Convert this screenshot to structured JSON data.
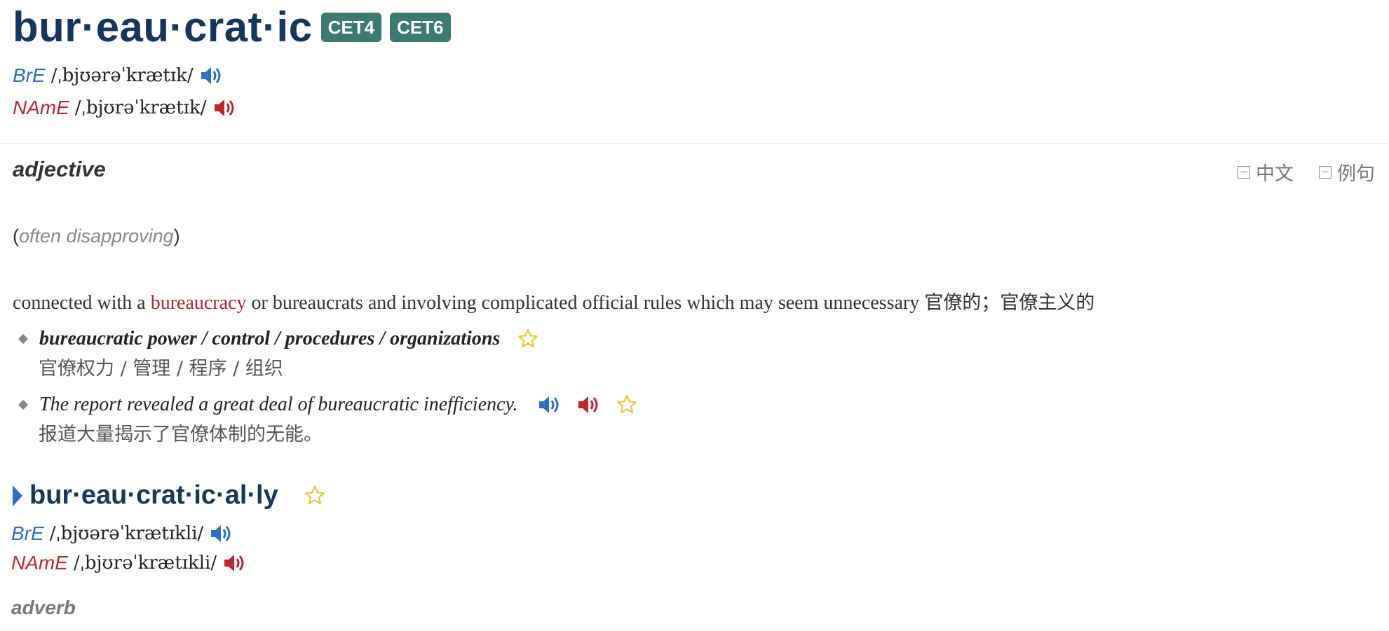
{
  "entry": {
    "headword": "bur·eau·crat·ic",
    "badges": [
      "CET4",
      "CET6"
    ],
    "pron": {
      "bre_label": "BrE",
      "bre_ipa": "/ˌbjʊərəˈkrætɪk/",
      "name_label": "NAmE",
      "name_ipa": "/ˌbjʊrəˈkrætɪk/"
    }
  },
  "sense": {
    "part_of_speech": "adjective",
    "controls": [
      "中文",
      "例句"
    ],
    "label_open": "(",
    "label_text": "often disapproving",
    "label_close": ")",
    "def_pre": "connected with a ",
    "def_xref": "bureaucracy",
    "def_post": " or bureaucrats and involving complicated official rules which may seem unnecessary ",
    "def_zh": "官僚的；官僚主义的",
    "examples": [
      {
        "en": "bureaucratic power / control / procedures / organizations",
        "zh": "官僚权力 / 管理 / 程序 / 组织"
      },
      {
        "en": "The report revealed a great deal of bureaucratic inefficiency.",
        "zh": "报道大量揭示了官僚体制的无能。"
      }
    ]
  },
  "derivative": {
    "word": "bur·eau·crat·ic·al·ly",
    "bre_label": "BrE",
    "bre_ipa": "/ˌbjʊərəˈkrætɪkli/",
    "name_label": "NAmE",
    "name_ipa": "/ˌbjʊrəˈkrætɪkli/",
    "part_of_speech": "adverb"
  },
  "colors": {
    "headword": "#17365d",
    "badge": "#3a7a70",
    "bre": "#2f6fc4",
    "name": "#c0262d",
    "star": "#f0c33c"
  }
}
